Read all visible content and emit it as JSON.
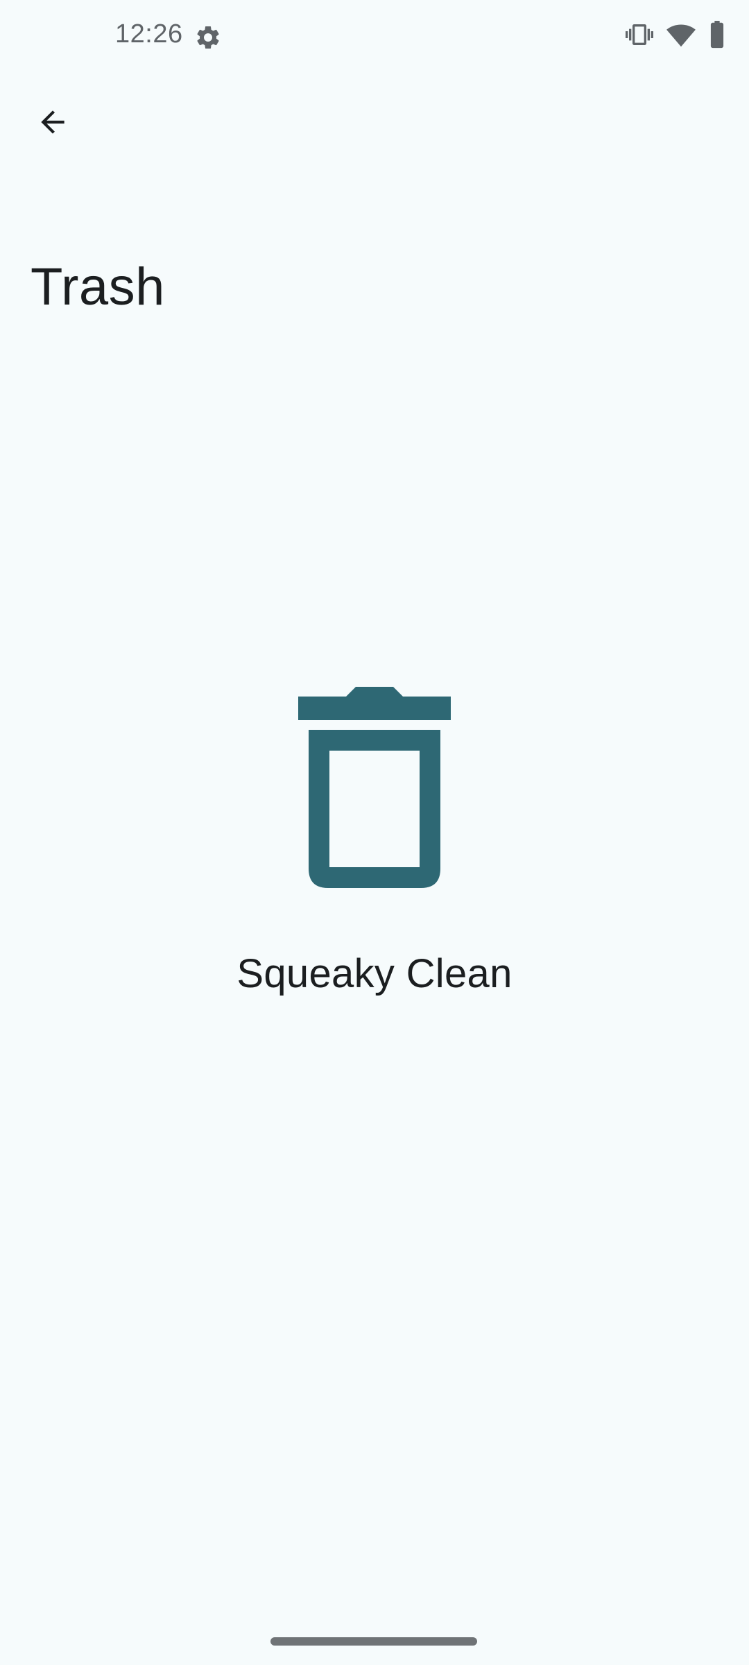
{
  "status_bar": {
    "time": "12:26",
    "icons": [
      "settings-gear-icon",
      "vibrate-icon",
      "wifi-icon",
      "battery-icon"
    ]
  },
  "toolbar": {
    "back_icon": "arrow-back-icon"
  },
  "page": {
    "title": "Trash"
  },
  "empty_state": {
    "icon": "trash-can-icon",
    "message": "Squeaky Clean"
  },
  "colors": {
    "background": "#f6fbfc",
    "accent": "#2e6874",
    "text": "#1b1e20",
    "status_icons": "#5f6468"
  }
}
